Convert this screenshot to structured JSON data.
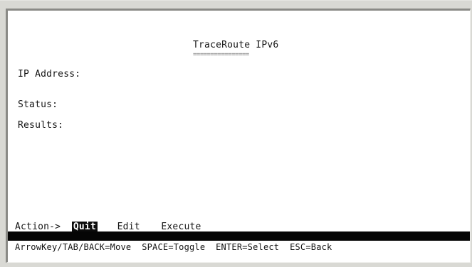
{
  "screen": {
    "title": "TraceRoute IPv6",
    "title_underline": "================",
    "fields": {
      "ip_address": {
        "label": "IP Address:",
        "value": ""
      },
      "status": {
        "label": "Status:",
        "value": ""
      },
      "results": {
        "label": "Results:",
        "value": ""
      }
    }
  },
  "action_bar": {
    "label": "Action->",
    "items": [
      {
        "label": "Quit",
        "selected": true
      },
      {
        "label": "Edit",
        "selected": false
      },
      {
        "label": "Execute",
        "selected": false
      }
    ]
  },
  "help_line": "ArrowKey/TAB/BACK=Move  SPACE=Toggle  ENTER=Select  ESC=Back",
  "colors": {
    "background": "#ffffff",
    "text": "#141414",
    "highlight_bg": "#0c0c0c",
    "highlight_text": "#ffffff",
    "frame": "#d9d9d4"
  }
}
